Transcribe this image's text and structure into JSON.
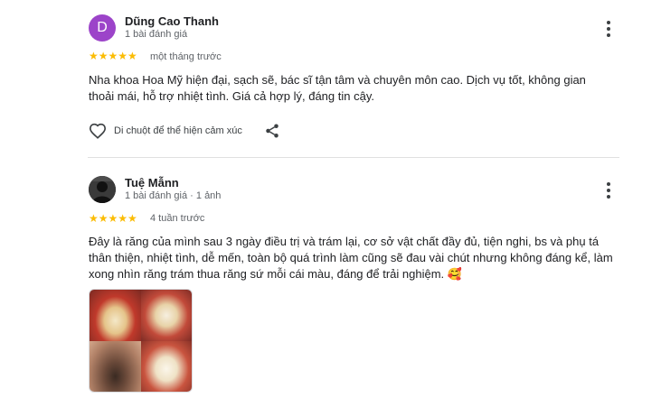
{
  "reviews": [
    {
      "avatar_letter": "D",
      "avatar_color": "#9c44c9",
      "name": "Dũng Cao Thanh",
      "meta": "1 bài đánh giá",
      "stars": "★★★★★",
      "rating": 5,
      "time": "một tháng trước",
      "text": "Nha khoa Hoa Mỹ hiện đại, sạch sẽ, bác sĩ tận tâm và chuyên môn cao. Dịch vụ tốt, không gian thoải mái, hỗ trợ nhiệt tình. Giá cả hợp lý, đáng tin cậy.",
      "react_label": "Di chuột để thể hiện cảm xúc"
    },
    {
      "name": "Tuệ Mẫnn",
      "meta": "1 bài đánh giá · 1 ảnh",
      "stars": "★★★★★",
      "rating": 5,
      "time": "4 tuần trước",
      "text": "Đây là răng của mình sau 3 ngày điều trị và trám lại, cơ sở vật chất đầy đủ, tiện nghi, bs và phụ tá thân thiện, nhiệt tình, dễ mến, toàn bộ quá trình làm cũng sẽ đau vài chút nhưng không đáng kể, làm xong nhìn răng trám thua răng sứ mỗi cái màu, đáng để trải nghiệm. 🥰"
    }
  ]
}
